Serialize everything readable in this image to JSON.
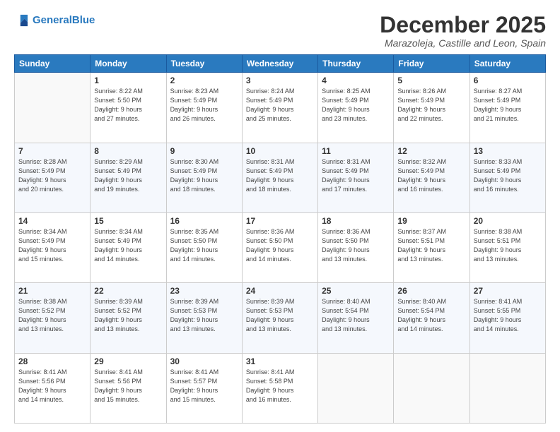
{
  "logo": {
    "line1": "General",
    "line2": "Blue"
  },
  "header": {
    "title": "December 2025",
    "subtitle": "Marazoleja, Castille and Leon, Spain"
  },
  "weekdays": [
    "Sunday",
    "Monday",
    "Tuesday",
    "Wednesday",
    "Thursday",
    "Friday",
    "Saturday"
  ],
  "weeks": [
    [
      {
        "day": "",
        "info": ""
      },
      {
        "day": "1",
        "info": "Sunrise: 8:22 AM\nSunset: 5:50 PM\nDaylight: 9 hours\nand 27 minutes."
      },
      {
        "day": "2",
        "info": "Sunrise: 8:23 AM\nSunset: 5:49 PM\nDaylight: 9 hours\nand 26 minutes."
      },
      {
        "day": "3",
        "info": "Sunrise: 8:24 AM\nSunset: 5:49 PM\nDaylight: 9 hours\nand 25 minutes."
      },
      {
        "day": "4",
        "info": "Sunrise: 8:25 AM\nSunset: 5:49 PM\nDaylight: 9 hours\nand 23 minutes."
      },
      {
        "day": "5",
        "info": "Sunrise: 8:26 AM\nSunset: 5:49 PM\nDaylight: 9 hours\nand 22 minutes."
      },
      {
        "day": "6",
        "info": "Sunrise: 8:27 AM\nSunset: 5:49 PM\nDaylight: 9 hours\nand 21 minutes."
      }
    ],
    [
      {
        "day": "7",
        "info": "Sunrise: 8:28 AM\nSunset: 5:49 PM\nDaylight: 9 hours\nand 20 minutes."
      },
      {
        "day": "8",
        "info": "Sunrise: 8:29 AM\nSunset: 5:49 PM\nDaylight: 9 hours\nand 19 minutes."
      },
      {
        "day": "9",
        "info": "Sunrise: 8:30 AM\nSunset: 5:49 PM\nDaylight: 9 hours\nand 18 minutes."
      },
      {
        "day": "10",
        "info": "Sunrise: 8:31 AM\nSunset: 5:49 PM\nDaylight: 9 hours\nand 18 minutes."
      },
      {
        "day": "11",
        "info": "Sunrise: 8:31 AM\nSunset: 5:49 PM\nDaylight: 9 hours\nand 17 minutes."
      },
      {
        "day": "12",
        "info": "Sunrise: 8:32 AM\nSunset: 5:49 PM\nDaylight: 9 hours\nand 16 minutes."
      },
      {
        "day": "13",
        "info": "Sunrise: 8:33 AM\nSunset: 5:49 PM\nDaylight: 9 hours\nand 16 minutes."
      }
    ],
    [
      {
        "day": "14",
        "info": "Sunrise: 8:34 AM\nSunset: 5:49 PM\nDaylight: 9 hours\nand 15 minutes."
      },
      {
        "day": "15",
        "info": "Sunrise: 8:34 AM\nSunset: 5:49 PM\nDaylight: 9 hours\nand 14 minutes."
      },
      {
        "day": "16",
        "info": "Sunrise: 8:35 AM\nSunset: 5:50 PM\nDaylight: 9 hours\nand 14 minutes."
      },
      {
        "day": "17",
        "info": "Sunrise: 8:36 AM\nSunset: 5:50 PM\nDaylight: 9 hours\nand 14 minutes."
      },
      {
        "day": "18",
        "info": "Sunrise: 8:36 AM\nSunset: 5:50 PM\nDaylight: 9 hours\nand 13 minutes."
      },
      {
        "day": "19",
        "info": "Sunrise: 8:37 AM\nSunset: 5:51 PM\nDaylight: 9 hours\nand 13 minutes."
      },
      {
        "day": "20",
        "info": "Sunrise: 8:38 AM\nSunset: 5:51 PM\nDaylight: 9 hours\nand 13 minutes."
      }
    ],
    [
      {
        "day": "21",
        "info": "Sunrise: 8:38 AM\nSunset: 5:52 PM\nDaylight: 9 hours\nand 13 minutes."
      },
      {
        "day": "22",
        "info": "Sunrise: 8:39 AM\nSunset: 5:52 PM\nDaylight: 9 hours\nand 13 minutes."
      },
      {
        "day": "23",
        "info": "Sunrise: 8:39 AM\nSunset: 5:53 PM\nDaylight: 9 hours\nand 13 minutes."
      },
      {
        "day": "24",
        "info": "Sunrise: 8:39 AM\nSunset: 5:53 PM\nDaylight: 9 hours\nand 13 minutes."
      },
      {
        "day": "25",
        "info": "Sunrise: 8:40 AM\nSunset: 5:54 PM\nDaylight: 9 hours\nand 13 minutes."
      },
      {
        "day": "26",
        "info": "Sunrise: 8:40 AM\nSunset: 5:54 PM\nDaylight: 9 hours\nand 14 minutes."
      },
      {
        "day": "27",
        "info": "Sunrise: 8:41 AM\nSunset: 5:55 PM\nDaylight: 9 hours\nand 14 minutes."
      }
    ],
    [
      {
        "day": "28",
        "info": "Sunrise: 8:41 AM\nSunset: 5:56 PM\nDaylight: 9 hours\nand 14 minutes."
      },
      {
        "day": "29",
        "info": "Sunrise: 8:41 AM\nSunset: 5:56 PM\nDaylight: 9 hours\nand 15 minutes."
      },
      {
        "day": "30",
        "info": "Sunrise: 8:41 AM\nSunset: 5:57 PM\nDaylight: 9 hours\nand 15 minutes."
      },
      {
        "day": "31",
        "info": "Sunrise: 8:41 AM\nSunset: 5:58 PM\nDaylight: 9 hours\nand 16 minutes."
      },
      {
        "day": "",
        "info": ""
      },
      {
        "day": "",
        "info": ""
      },
      {
        "day": "",
        "info": ""
      }
    ]
  ]
}
